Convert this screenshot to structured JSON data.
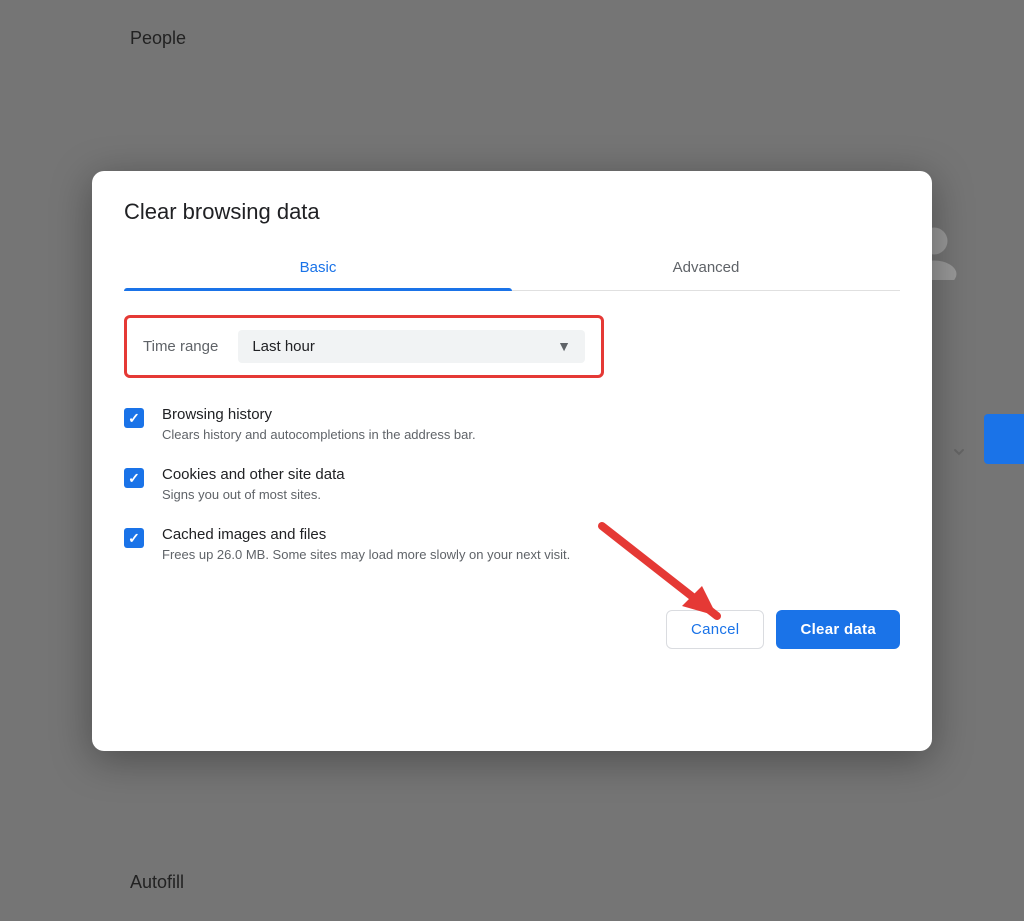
{
  "background": {
    "people_label": "People",
    "autofill_label": "Autofill"
  },
  "modal": {
    "title": "Clear browsing data",
    "tabs": [
      {
        "id": "basic",
        "label": "Basic",
        "active": true
      },
      {
        "id": "advanced",
        "label": "Advanced",
        "active": false
      }
    ],
    "time_range": {
      "label": "Time range",
      "value": "Last hour",
      "dropdown_aria": "Time range dropdown"
    },
    "checkboxes": [
      {
        "id": "browsing-history",
        "title": "Browsing history",
        "description": "Clears history and autocompletions in the address bar.",
        "checked": true
      },
      {
        "id": "cookies",
        "title": "Cookies and other site data",
        "description": "Signs you out of most sites.",
        "checked": true
      },
      {
        "id": "cached-images",
        "title": "Cached images and files",
        "description": "Frees up 26.0 MB. Some sites may load more slowly on your next visit.",
        "checked": true
      }
    ],
    "footer": {
      "cancel_label": "Cancel",
      "clear_label": "Clear data"
    }
  }
}
